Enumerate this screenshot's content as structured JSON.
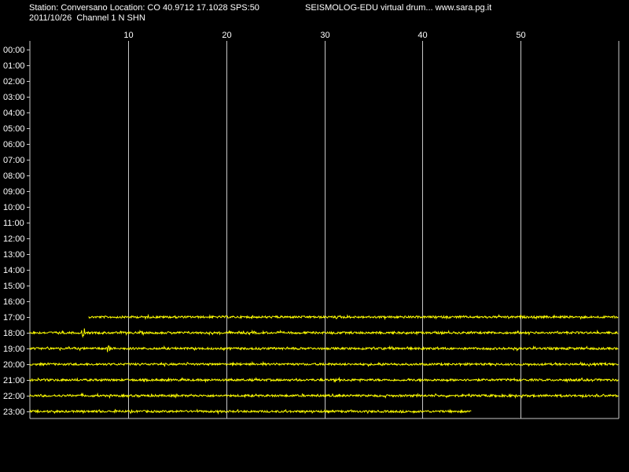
{
  "header": {
    "station_line": "Station: Conversano Location: CO 40.9712 17.1028 SPS:50",
    "date_line": "2011/10/26  Channel 1 N SHN",
    "brand_line": "SEISMOLOG-EDU virtual drum... www.sara.pg.it"
  },
  "chart_data": {
    "type": "line",
    "title": "",
    "xlabel": "",
    "ylabel": "",
    "x_ticks": [
      "10",
      "20",
      "30",
      "40",
      "50"
    ],
    "x_tick_values": [
      10,
      20,
      30,
      40,
      50
    ],
    "xlim": [
      0,
      60
    ],
    "row_labels": [
      "00:00",
      "01:00",
      "02:00",
      "03:00",
      "04:00",
      "05:00",
      "06:00",
      "07:00",
      "08:00",
      "09:00",
      "10:00",
      "11:00",
      "12:00",
      "13:00",
      "14:00",
      "15:00",
      "16:00",
      "17:00",
      "18:00",
      "19:00",
      "20:00",
      "21:00",
      "22:00",
      "23:00"
    ],
    "grid": "vertical lines at each minute tick",
    "trace_color": "#ffff00",
    "grid_color": "#c8c8c8",
    "background": "#000000",
    "series": [
      {
        "hour": "17:00",
        "start_min": 6.0,
        "end_min": 60.0
      },
      {
        "hour": "18:00",
        "start_min": 0.0,
        "end_min": 60.0,
        "events_min": [
          5.4
        ]
      },
      {
        "hour": "19:00",
        "start_min": 0.0,
        "end_min": 60.0,
        "events_min": [
          8.0
        ]
      },
      {
        "hour": "20:00",
        "start_min": 0.0,
        "end_min": 60.0
      },
      {
        "hour": "21:00",
        "start_min": 0.0,
        "end_min": 60.0
      },
      {
        "hour": "22:00",
        "start_min": 0.0,
        "end_min": 60.0
      },
      {
        "hour": "23:00",
        "start_min": 0.0,
        "end_min": 45.0
      }
    ]
  }
}
